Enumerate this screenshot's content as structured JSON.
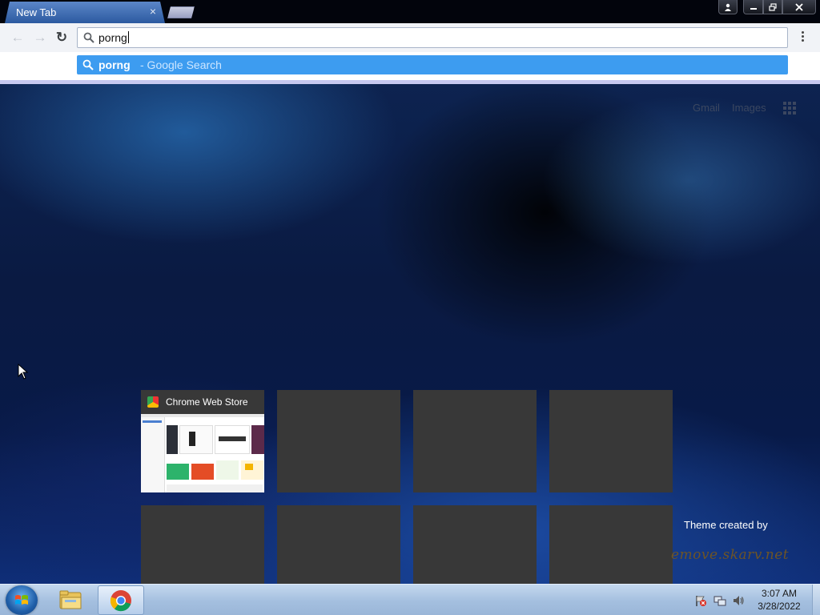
{
  "tab": {
    "title": "New Tab",
    "close_glyph": "×"
  },
  "window_controls": {
    "profile": "profile-icon",
    "minimize": "minimize-icon",
    "maximize": "restore-icon",
    "close": "close-icon"
  },
  "toolbar": {
    "back": "←",
    "forward": "→",
    "reload": "↻",
    "omnibox_value": "porng"
  },
  "suggestion": {
    "query": "porng",
    "rest": "- Google Search"
  },
  "ntp": {
    "gmail": "Gmail",
    "images": "Images",
    "tiles": [
      {
        "title": "Chrome Web Store"
      },
      {
        "title": ""
      },
      {
        "title": ""
      },
      {
        "title": ""
      },
      {
        "title": ""
      },
      {
        "title": ""
      },
      {
        "title": ""
      },
      {
        "title": ""
      }
    ],
    "theme_credit": "Theme created by",
    "theme_url": "emove.skarv.net"
  },
  "taskbar": {
    "time": "3:07 AM",
    "date": "3/28/2022"
  },
  "colors": {
    "accent": "#3d9cf0",
    "tile": "#383838",
    "taskbar": "#a4bfdf"
  }
}
